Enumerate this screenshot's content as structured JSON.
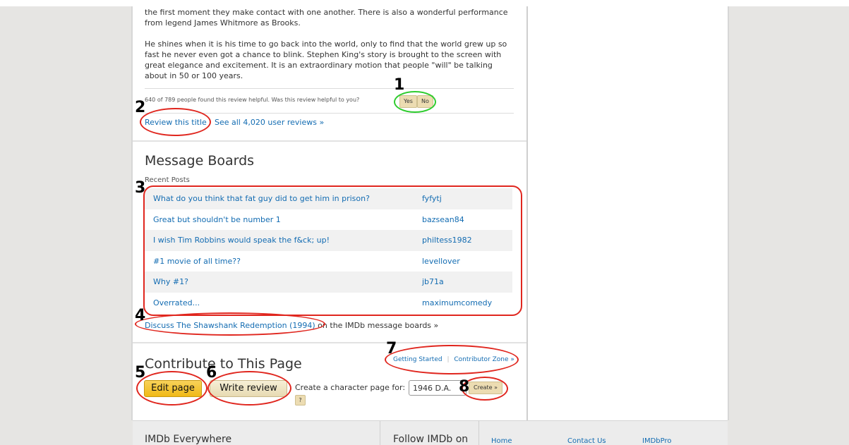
{
  "review": {
    "para1_line1": "the first moment they make contact with one another. There is also a wonderful performance",
    "para1_line2": "from legend James Whitmore as Brooks.",
    "para2_line1": "He shines when it is his time to go back into the world, only to find that the world grew up so",
    "para2_line2": "fast he never even got a chance to blink. Stephen King's story is brought to the screen with",
    "para2_line3": "great elegance and excitement. It is an extraordinary motion that people \"will\" be talking",
    "para2_line4": "about in 50 or 100 years.",
    "helpful_text": "640 of 789 people found this review helpful.  Was this review helpful to you?",
    "yes_label": "Yes",
    "no_label": "No",
    "review_this_title": "Review this title",
    "see_all_reviews": "See all 4,020 user reviews »"
  },
  "message_boards": {
    "heading": "Message Boards",
    "recent_label": "Recent Posts",
    "posts": [
      {
        "title": "What do you think that fat guy did to get him in prison?",
        "author": "fyfytj"
      },
      {
        "title": "Great but shouldn't be number 1",
        "author": "bazsean84"
      },
      {
        "title": "I wish Tim Robbins would speak the f&ck; up!",
        "author": "philtess1982"
      },
      {
        "title": "#1 movie of all time??",
        "author": "levellover"
      },
      {
        "title": "Why #1?",
        "author": "jb71a"
      },
      {
        "title": "Overrated...",
        "author": "maximumcomedy"
      }
    ],
    "discuss_link": "Discuss The Shawshank Redemption (1994)",
    "discuss_suffix": " on the IMDb message boards »"
  },
  "contribute": {
    "heading": "Contribute to This Page",
    "getting_started": "Getting Started",
    "separator": "|",
    "contributor_zone": "Contributor Zone »",
    "edit_page": "Edit page",
    "write_review": "Write review",
    "character_label": "Create a character page for:",
    "character_selected": "1946 D.A.",
    "create_label": "Create »",
    "help_label": "?"
  },
  "footer": {
    "everywhere": "IMDb Everywhere",
    "follow": "Follow IMDb on",
    "links": [
      "Home",
      "Contact Us",
      "IMDbPro"
    ]
  },
  "annotations": [
    "1",
    "2",
    "3",
    "4",
    "5",
    "6",
    "7",
    "8"
  ],
  "colors": {
    "annotation_green": "#2ecc2e",
    "annotation_red": "#e0261e",
    "link_blue": "#136cb2",
    "edit_yellow": "#f5c518"
  }
}
